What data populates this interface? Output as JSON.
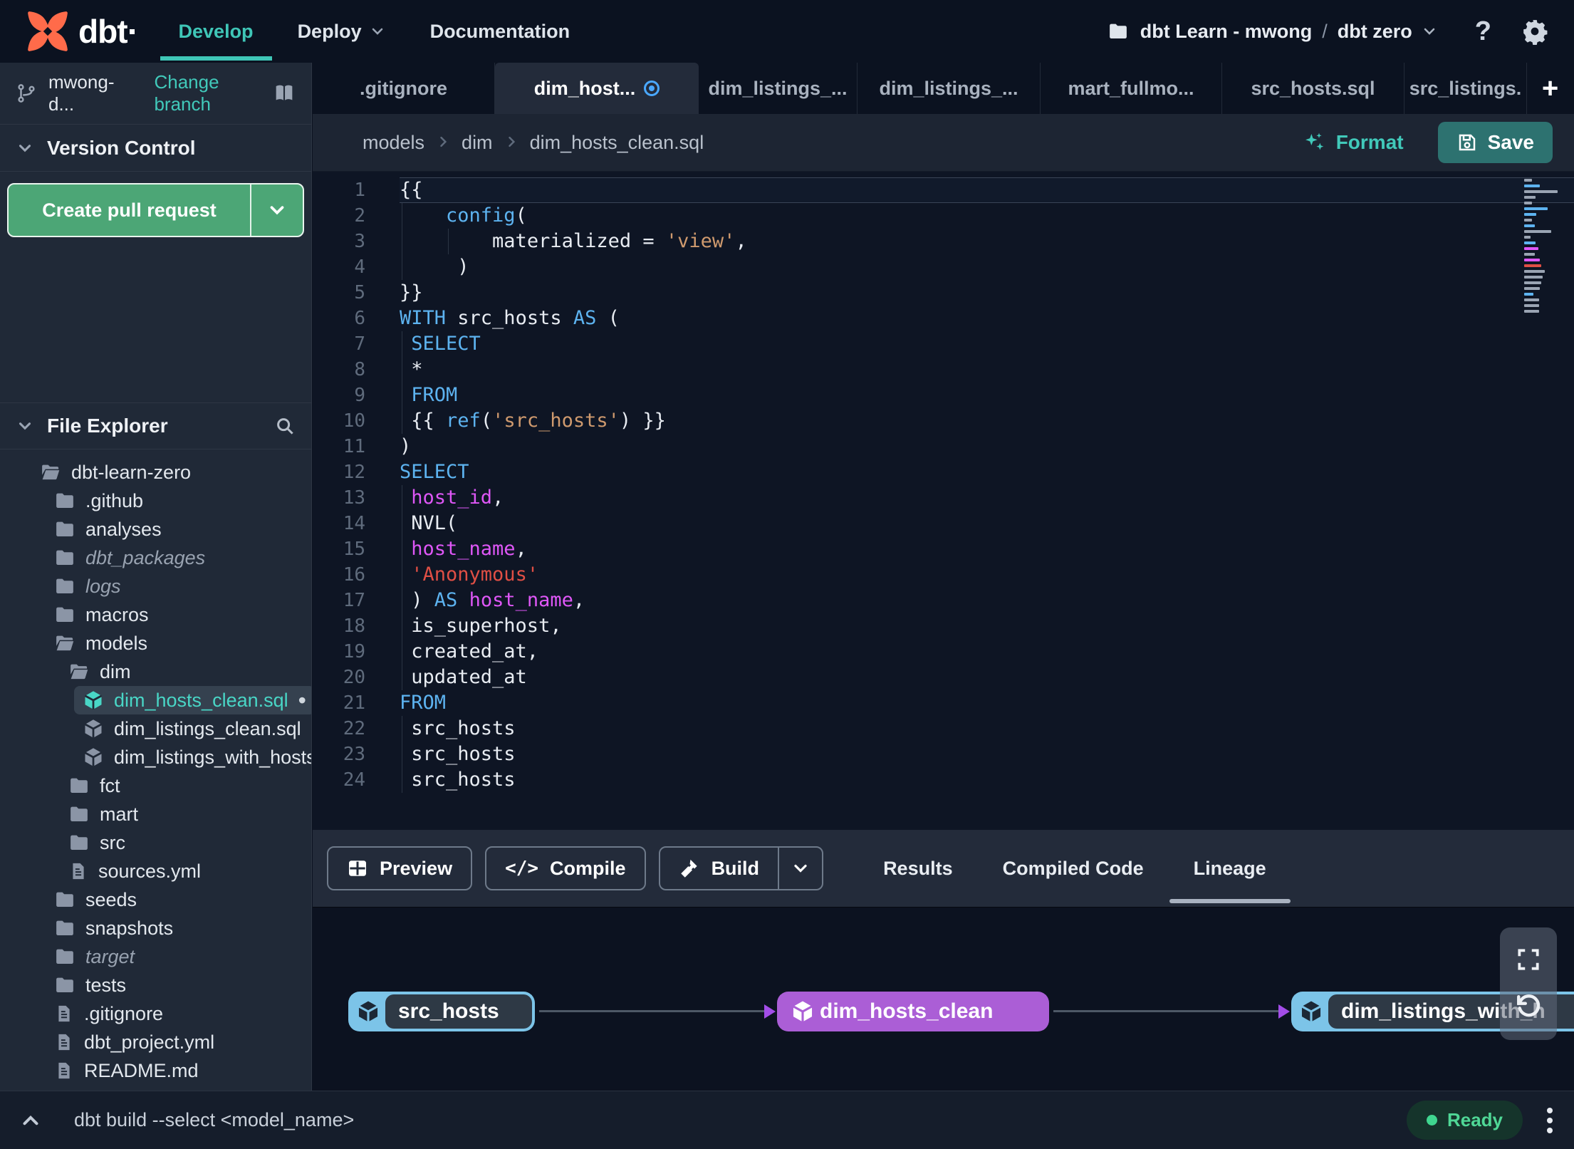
{
  "topnav": {
    "logo_text": "dbt",
    "items": [
      {
        "label": "Develop",
        "active": true
      },
      {
        "label": "Deploy",
        "active": false,
        "icon": "chevron-down-icon"
      },
      {
        "label": "Documentation",
        "active": false
      }
    ],
    "project": {
      "icon": "folder-icon",
      "repo": "dbt Learn - mwong",
      "separator": "/",
      "environment": "dbt zero",
      "caret_icon": "chevron-down-icon"
    },
    "help_icon": "help-icon",
    "help_glyph": "?",
    "gear_icon": "gear-icon"
  },
  "sidebar": {
    "branch": {
      "icon": "git-branch-icon",
      "name": "mwong-d...",
      "action_label": "Change branch",
      "book_icon": "book-icon"
    },
    "version_control": {
      "title": "Version Control",
      "chevron_icon": "chevron-down-icon",
      "create_pr_label": "Create pull request"
    },
    "file_explorer": {
      "title": "File Explorer",
      "chevron_icon": "chevron-down-icon",
      "search_icon": "search-icon"
    },
    "tree": [
      {
        "label": "dbt-learn-zero",
        "icon": "folder-open-icon",
        "depth": 0
      },
      {
        "label": ".github",
        "icon": "folder-icon",
        "depth": 1
      },
      {
        "label": "analyses",
        "icon": "folder-icon",
        "depth": 1
      },
      {
        "label": "dbt_packages",
        "icon": "folder-icon",
        "depth": 1,
        "muted": true
      },
      {
        "label": "logs",
        "icon": "folder-icon",
        "depth": 1,
        "muted": true
      },
      {
        "label": "macros",
        "icon": "folder-icon",
        "depth": 1
      },
      {
        "label": "models",
        "icon": "folder-open-icon",
        "depth": 1
      },
      {
        "label": "dim",
        "icon": "folder-open-icon",
        "depth": 2
      },
      {
        "label": "dim_hosts_clean.sql",
        "icon": "model-icon",
        "depth": 3,
        "selected": true,
        "modified_dot": "•"
      },
      {
        "label": "dim_listings_clean.sql",
        "icon": "model-icon",
        "depth": 3
      },
      {
        "label": "dim_listings_with_hosts...",
        "icon": "model-icon",
        "depth": 3
      },
      {
        "label": "fct",
        "icon": "folder-icon",
        "depth": 2
      },
      {
        "label": "mart",
        "icon": "folder-icon",
        "depth": 2
      },
      {
        "label": "src",
        "icon": "folder-icon",
        "depth": 2
      },
      {
        "label": "sources.yml",
        "icon": "file-icon",
        "depth": 2
      },
      {
        "label": "seeds",
        "icon": "folder-icon",
        "depth": 1
      },
      {
        "label": "snapshots",
        "icon": "folder-icon",
        "depth": 1
      },
      {
        "label": "target",
        "icon": "folder-icon",
        "depth": 1,
        "muted": true
      },
      {
        "label": "tests",
        "icon": "folder-icon",
        "depth": 1
      },
      {
        "label": ".gitignore",
        "icon": "file-icon",
        "depth": 1
      },
      {
        "label": "dbt_project.yml",
        "icon": "file-icon",
        "depth": 1
      },
      {
        "label": "README.md",
        "icon": "file-icon",
        "depth": 1
      }
    ]
  },
  "tabs": {
    "items": [
      {
        "label": ".gitignore"
      },
      {
        "label": "dim_host...",
        "active": true,
        "modified": true
      },
      {
        "label": "dim_listings_..."
      },
      {
        "label": "dim_listings_..."
      },
      {
        "label": "mart_fullmo..."
      },
      {
        "label": "src_hosts.sql"
      },
      {
        "label": "src_listings."
      }
    ],
    "new_tab_icon": "plus-icon",
    "new_tab_glyph": "+"
  },
  "editor": {
    "breadcrumb": [
      "models",
      "dim",
      "dim_hosts_clean.sql"
    ],
    "format_label": "Format",
    "format_icon": "sparkles-icon",
    "save_label": "Save",
    "save_icon": "floppy-icon",
    "lines": [
      {
        "n": 1,
        "cur": true,
        "s": [
          [
            "{{",
            "pl"
          ]
        ]
      },
      {
        "n": 2,
        "g": [
          0
        ],
        "s": [
          [
            "    ",
            "pl"
          ],
          [
            "config",
            "kw"
          ],
          [
            "(",
            "pl"
          ]
        ]
      },
      {
        "n": 3,
        "g": [
          0,
          4
        ],
        "s": [
          [
            "        ",
            "pl"
          ],
          [
            "materialized = ",
            "pl"
          ],
          [
            "'view'",
            "so"
          ],
          [
            ",",
            "pl"
          ]
        ]
      },
      {
        "n": 4,
        "g": [
          0
        ],
        "s": [
          [
            "     )",
            "pl"
          ]
        ]
      },
      {
        "n": 5,
        "s": [
          [
            "}}",
            "pl"
          ]
        ]
      },
      {
        "n": 6,
        "s": [
          [
            "WITH",
            "kw"
          ],
          [
            " src_hosts ",
            "pl"
          ],
          [
            "AS",
            "kw"
          ],
          [
            " (",
            "pl"
          ]
        ]
      },
      {
        "n": 7,
        "g": [
          0
        ],
        "s": [
          [
            " ",
            "pl"
          ],
          [
            "SELECT",
            "kw"
          ]
        ]
      },
      {
        "n": 8,
        "g": [
          0
        ],
        "s": [
          [
            " *",
            "pl"
          ]
        ]
      },
      {
        "n": 9,
        "g": [
          0
        ],
        "s": [
          [
            " ",
            "pl"
          ],
          [
            "FROM",
            "kw"
          ]
        ]
      },
      {
        "n": 10,
        "g": [
          0
        ],
        "s": [
          [
            " {{ ",
            "pl"
          ],
          [
            "ref",
            "kw"
          ],
          [
            "(",
            "pl"
          ],
          [
            "'src_hosts'",
            "so"
          ],
          [
            ") }}",
            "pl"
          ]
        ]
      },
      {
        "n": 11,
        "s": [
          [
            ")",
            "pl"
          ]
        ]
      },
      {
        "n": 12,
        "s": [
          [
            "SELECT",
            "kw"
          ]
        ]
      },
      {
        "n": 13,
        "g": [
          0
        ],
        "s": [
          [
            " ",
            "pl"
          ],
          [
            "host_id",
            "mg"
          ],
          [
            ",",
            "pl"
          ]
        ]
      },
      {
        "n": 14,
        "g": [
          0
        ],
        "s": [
          [
            " NVL(",
            "pl"
          ]
        ]
      },
      {
        "n": 15,
        "g": [
          0
        ],
        "s": [
          [
            " ",
            "pl"
          ],
          [
            "host_name",
            "mg"
          ],
          [
            ",",
            "pl"
          ]
        ]
      },
      {
        "n": 16,
        "g": [
          0
        ],
        "s": [
          [
            " ",
            "pl"
          ],
          [
            "'Anonymous'",
            "sr"
          ]
        ]
      },
      {
        "n": 17,
        "g": [
          0
        ],
        "s": [
          [
            " ) ",
            "pl"
          ],
          [
            "AS",
            "kw"
          ],
          [
            " ",
            "pl"
          ],
          [
            "host_name",
            "mg"
          ],
          [
            ",",
            "pl"
          ]
        ]
      },
      {
        "n": 18,
        "g": [
          0
        ],
        "s": [
          [
            " is_superhost,",
            "pl"
          ]
        ]
      },
      {
        "n": 19,
        "g": [
          0
        ],
        "s": [
          [
            " created_at,",
            "pl"
          ]
        ]
      },
      {
        "n": 20,
        "g": [
          0
        ],
        "s": [
          [
            " updated_at",
            "pl"
          ]
        ]
      },
      {
        "n": 21,
        "s": [
          [
            "FROM",
            "kw"
          ]
        ]
      },
      {
        "n": 22,
        "g": [
          0
        ],
        "s": [
          [
            " src_hosts",
            "pl"
          ]
        ]
      },
      {
        "n": 23,
        "g": [
          0
        ],
        "s": [
          [
            " src_hosts",
            "pl"
          ]
        ]
      },
      {
        "n": 24,
        "g": [
          0
        ],
        "s": [
          [
            " src_hosts",
            "pl"
          ]
        ]
      }
    ]
  },
  "bottom_panel": {
    "buttons": [
      {
        "label": "Preview",
        "icon": "grid-icon"
      },
      {
        "label": "Compile",
        "icon": "code-icon",
        "glyph": "</>"
      },
      {
        "label": "Build",
        "icon": "hammer-icon",
        "split": true,
        "caret_icon": "chevron-down-icon"
      }
    ],
    "tabs": [
      {
        "label": "Results"
      },
      {
        "label": "Compiled Code"
      },
      {
        "label": "Lineage",
        "active": true
      }
    ]
  },
  "lineage": {
    "nodes": [
      {
        "label": "src_hosts",
        "color": "blue",
        "icon": "model-cube-icon"
      },
      {
        "label": "dim_hosts_clean",
        "color": "purple",
        "icon": "model-cube-icon"
      },
      {
        "label": "dim_listings_with_h",
        "color": "blue",
        "icon": "model-cube-icon"
      }
    ],
    "controls": [
      {
        "icon": "expand-icon"
      },
      {
        "icon": "refresh-icon"
      }
    ]
  },
  "statusbar": {
    "chevron_icon": "chevron-up-icon",
    "command": "dbt build --select <model_name>",
    "status_label": "Ready",
    "menu_icon": "kebab-icon"
  },
  "colors": {
    "accent_teal": "#41c9ba",
    "green_button": "#4ca676",
    "save_teal": "#2d7270",
    "tab_modified_blue": "#4aa8ff",
    "node_blue": "#7cc4e8",
    "node_purple": "#ab5ed6",
    "status_green": "#3fd68f",
    "keyword_blue": "#5db3f0",
    "string_orange": "#cf9a6e",
    "string_red": "#e04f45",
    "identifier_magenta": "#df57f7"
  }
}
